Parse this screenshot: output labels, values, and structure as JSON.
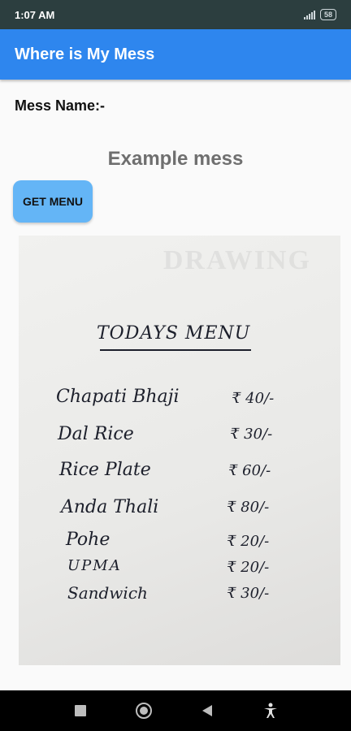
{
  "status_bar": {
    "time": "1:07 AM",
    "battery": "58"
  },
  "app_bar": {
    "title": "Where is My Mess"
  },
  "mess_label": "Mess Name:-",
  "mess_name": "Example mess",
  "get_menu_button": "GET MENU",
  "menu_image": {
    "title": "TODAYS MENU",
    "items": [
      {
        "name": "Chapati Bhaji",
        "price": "₹ 40/-"
      },
      {
        "name": "Dal Rice",
        "price": "₹ 30/-"
      },
      {
        "name": "Rice Plate",
        "price": "₹ 60/-"
      },
      {
        "name": "Anda Thali",
        "price": "₹ 80/-"
      },
      {
        "name": "Pohe",
        "price": "₹ 20/-"
      },
      {
        "name": "UPMA",
        "price": "₹ 20/-"
      },
      {
        "name": "Sandwich",
        "price": "₹ 30/-"
      }
    ]
  },
  "nav_bar": {
    "icons": [
      "recents-icon",
      "home-icon",
      "back-icon",
      "accessibility-icon"
    ]
  }
}
